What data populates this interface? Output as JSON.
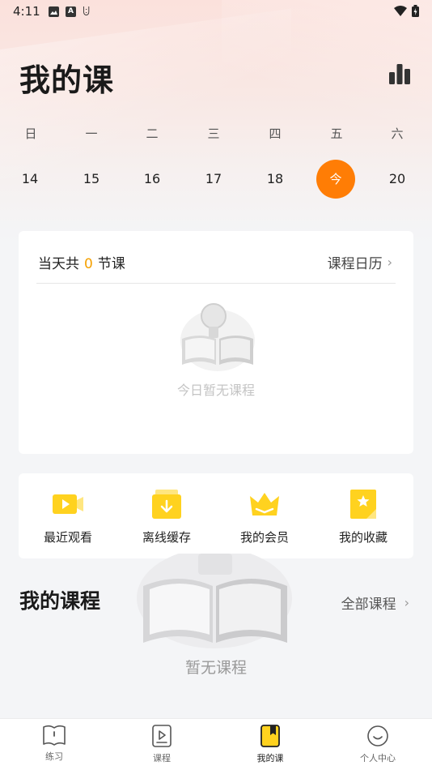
{
  "status_bar": {
    "time": "4:11",
    "icons": [
      "image-icon",
      "a-icon",
      "scan-icon",
      "wifi-icon",
      "battery-icon"
    ],
    "a_glyph": "A",
    "scan_glyph": "ꖹ"
  },
  "header": {
    "title": "我的课",
    "stats_icon": "bar-chart-icon"
  },
  "week": {
    "labels": [
      "日",
      "一",
      "二",
      "三",
      "四",
      "五",
      "六"
    ],
    "dates": [
      "14",
      "15",
      "16",
      "17",
      "18",
      "今",
      "20"
    ],
    "today_index": 5,
    "today_color": "#ff7d05"
  },
  "today_card": {
    "prefix": "当天共",
    "count": "0",
    "suffix": "节课",
    "calendar_link": "课程日历",
    "empty_text": "今日暂无课程"
  },
  "shortcuts": [
    {
      "label": "最近观看",
      "icon": "video-icon"
    },
    {
      "label": "离线缓存",
      "icon": "download-folder-icon"
    },
    {
      "label": "我的会员",
      "icon": "crown-icon"
    },
    {
      "label": "我的收藏",
      "icon": "star-bookmark-icon"
    }
  ],
  "my_courses": {
    "title": "我的课程",
    "all_link": "全部课程",
    "empty_text": "暂无课程"
  },
  "tabbar": [
    {
      "label": "练习",
      "icon": "book-icon",
      "active": false
    },
    {
      "label": "课程",
      "icon": "play-board-icon",
      "active": false
    },
    {
      "label": "我的课",
      "icon": "my-course-icon",
      "active": true
    },
    {
      "label": "个人中心",
      "icon": "smile-icon",
      "active": false
    }
  ],
  "colors": {
    "accent": "#ff7d05",
    "icon_yellow": "#ffd21f",
    "count_color": "#f5a000"
  }
}
